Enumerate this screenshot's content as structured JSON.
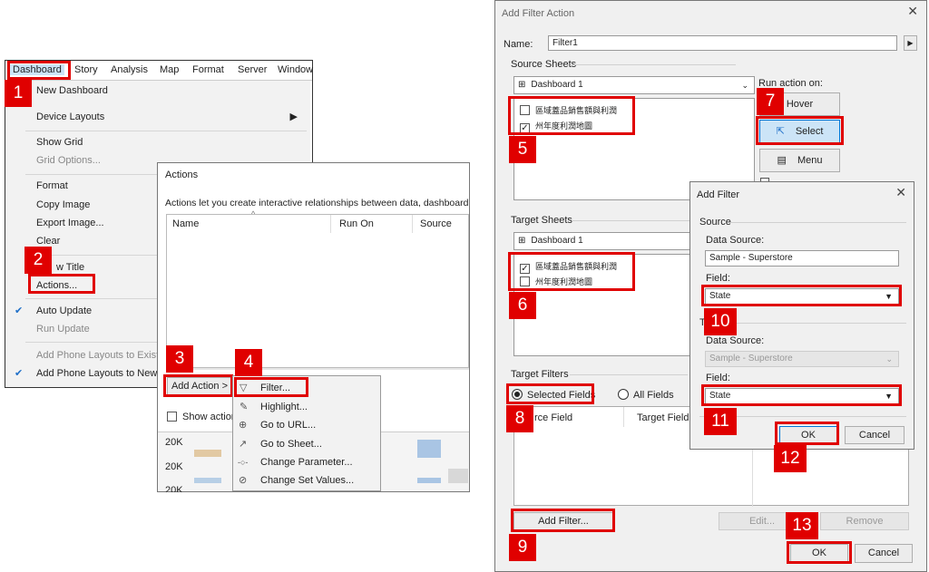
{
  "menubar": {
    "items": [
      "Dashboard",
      "Story",
      "Analysis",
      "Map",
      "Format",
      "Server",
      "Window"
    ]
  },
  "dashboard_menu": {
    "items": [
      "New Dashboard",
      "Device Layouts",
      "Show Grid",
      "Grid Options...",
      "Format",
      "Copy Image",
      "Export Image...",
      "Clear",
      "Show Title",
      "Actions...",
      "Auto Update",
      "Run Update",
      "Add Phone Layouts to Existing",
      "Add Phone Layouts to New"
    ],
    "show_title_partial": "w Title",
    "export_partial": "Export Image...",
    "add_existing_partial": "Add Phone Layouts to Existi",
    "add_new_partial": "Add Phone Layouts to New"
  },
  "actions_dialog": {
    "title": "Actions",
    "description": "Actions let you create interactive relationships between data, dashboard objects,",
    "columns": [
      "Name",
      "Run On",
      "Source"
    ],
    "add_action": "Add Action >",
    "show_actions": "Show actions",
    "axis_labels": [
      "20K",
      "20K",
      "20K"
    ]
  },
  "add_action_menu": {
    "items": [
      "Filter...",
      "Highlight...",
      "Go to URL...",
      "Go to Sheet...",
      "Change Parameter...",
      "Change Set Values..."
    ]
  },
  "filter_action": {
    "title": "Add Filter Action",
    "name_label": "Name:",
    "name_value": "Filter1",
    "source_sheets": "Source Sheets",
    "dashboard_combo": "Dashboard 1",
    "source_items": [
      "區域蓋品銷售額與利潤",
      "州年度利潤地圖"
    ],
    "run_action_on": "Run action on:",
    "hover": "Hover",
    "select": "Select",
    "menu": "Menu",
    "target_sheets": "Target Sheets",
    "target_combo": "Dashboard 1",
    "target_items": [
      "區域蓋品銷售額與利潤",
      "州年度利潤地圖"
    ],
    "target_filters": "Target Filters",
    "selected_fields": "Selected Fields",
    "all_fields": "All Fields",
    "col_source_field": "rce Field",
    "col_target_field": "Target Field",
    "add_filter": "Add Filter...",
    "edit": "Edit...",
    "remove": "Remove",
    "ok": "OK",
    "cancel": "Cancel"
  },
  "add_filter_dialog": {
    "title": "Add Filter",
    "source": "Source",
    "data_source_label": "Data Source:",
    "data_source_value": "Sample - Superstore",
    "field_label": "Field:",
    "field_value": "State",
    "target_partial": "T",
    "target_data_source_label": "Data Source:",
    "target_data_source_value": "Sample - Superstore",
    "target_field_label": "Field:",
    "target_field_value": "State",
    "ok": "OK",
    "cancel": "Cancel"
  },
  "steps": [
    "1",
    "2",
    "3",
    "4",
    "5",
    "6",
    "7",
    "8",
    "9",
    "10",
    "11",
    "12",
    "13"
  ],
  "colors": {
    "accent": "#e00000",
    "select_bg": "#cce4f7"
  }
}
